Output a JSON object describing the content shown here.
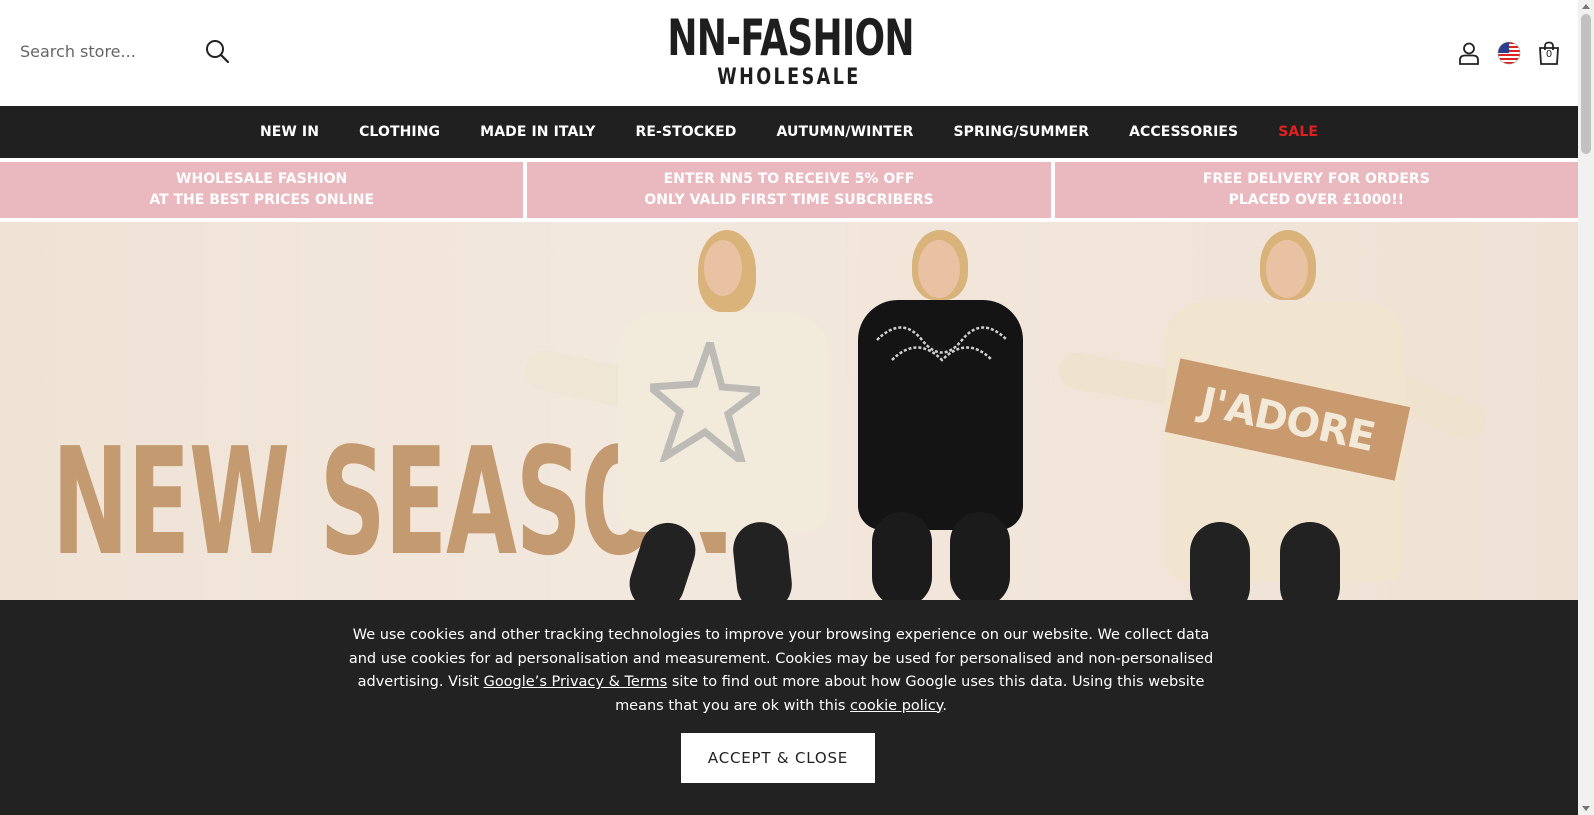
{
  "header": {
    "search": {
      "placeholder": "Search store...",
      "value": ""
    },
    "logo": {
      "main": "NN-FASHION",
      "sub": "WHOLESALE"
    },
    "icons": [
      "search-icon",
      "account-icon",
      "us-flag-icon",
      "shopping-bag-icon"
    ],
    "cart_count": "0"
  },
  "nav": {
    "items": [
      {
        "label": "NEW IN"
      },
      {
        "label": "CLOTHING"
      },
      {
        "label": "MADE IN ITALY"
      },
      {
        "label": "RE-STOCKED"
      },
      {
        "label": "AUTUMN/WINTER"
      },
      {
        "label": "SPRING/SUMMER"
      },
      {
        "label": "ACCESSORIES"
      },
      {
        "label": "SALE"
      }
    ],
    "sale_color": "#e02020",
    "background": "#202020"
  },
  "promos": [
    {
      "line1": "WHOLESALE FASHION",
      "line2": "AT THE BEST PRICES ONLINE"
    },
    {
      "line1": "ENTER NN5 TO RECEIVE 5% OFF",
      "line2": "ONLY VALID FIRST TIME SUBCRIBERS"
    },
    {
      "line1": "FREE DELIVERY FOR ORDERS",
      "line2": "PLACED OVER £1000!!"
    }
  ],
  "promo_color": "#eab9c0",
  "hero": {
    "title": "NEW SEASON",
    "title_color": "#c49a70",
    "sweater_text": "J'ADORE"
  },
  "cookie": {
    "text_part1": "We use cookies and other tracking technologies to improve your browsing experience on our website. We collect data and use cookies for ad personalisation and measurement. Cookies may be used for personalised and non-personalised advertising. Visit ",
    "privacy_link": "Google’s Privacy & Terms",
    "text_part2": " site to find out more about how Google uses this data. Using this website means that you are ok with this ",
    "policy_link": "cookie policy",
    "text_part3": ".",
    "accept_label": "ACCEPT & CLOSE"
  }
}
